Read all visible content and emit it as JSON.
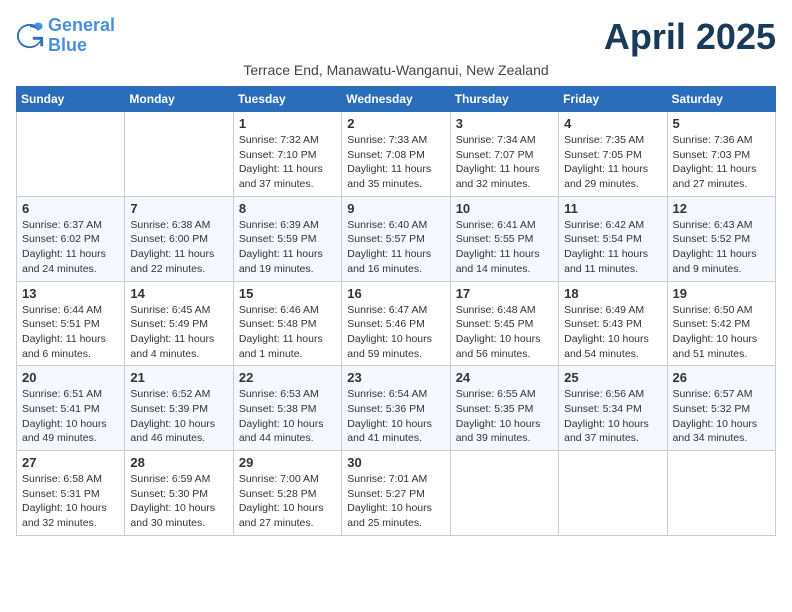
{
  "header": {
    "logo_line1": "General",
    "logo_line2": "Blue",
    "month": "April 2025",
    "subtitle": "Terrace End, Manawatu-Wanganui, New Zealand"
  },
  "days_of_week": [
    "Sunday",
    "Monday",
    "Tuesday",
    "Wednesday",
    "Thursday",
    "Friday",
    "Saturday"
  ],
  "weeks": [
    [
      {
        "day": "",
        "info": ""
      },
      {
        "day": "",
        "info": ""
      },
      {
        "day": "1",
        "info": "Sunrise: 7:32 AM\nSunset: 7:10 PM\nDaylight: 11 hours and 37 minutes."
      },
      {
        "day": "2",
        "info": "Sunrise: 7:33 AM\nSunset: 7:08 PM\nDaylight: 11 hours and 35 minutes."
      },
      {
        "day": "3",
        "info": "Sunrise: 7:34 AM\nSunset: 7:07 PM\nDaylight: 11 hours and 32 minutes."
      },
      {
        "day": "4",
        "info": "Sunrise: 7:35 AM\nSunset: 7:05 PM\nDaylight: 11 hours and 29 minutes."
      },
      {
        "day": "5",
        "info": "Sunrise: 7:36 AM\nSunset: 7:03 PM\nDaylight: 11 hours and 27 minutes."
      }
    ],
    [
      {
        "day": "6",
        "info": "Sunrise: 6:37 AM\nSunset: 6:02 PM\nDaylight: 11 hours and 24 minutes."
      },
      {
        "day": "7",
        "info": "Sunrise: 6:38 AM\nSunset: 6:00 PM\nDaylight: 11 hours and 22 minutes."
      },
      {
        "day": "8",
        "info": "Sunrise: 6:39 AM\nSunset: 5:59 PM\nDaylight: 11 hours and 19 minutes."
      },
      {
        "day": "9",
        "info": "Sunrise: 6:40 AM\nSunset: 5:57 PM\nDaylight: 11 hours and 16 minutes."
      },
      {
        "day": "10",
        "info": "Sunrise: 6:41 AM\nSunset: 5:55 PM\nDaylight: 11 hours and 14 minutes."
      },
      {
        "day": "11",
        "info": "Sunrise: 6:42 AM\nSunset: 5:54 PM\nDaylight: 11 hours and 11 minutes."
      },
      {
        "day": "12",
        "info": "Sunrise: 6:43 AM\nSunset: 5:52 PM\nDaylight: 11 hours and 9 minutes."
      }
    ],
    [
      {
        "day": "13",
        "info": "Sunrise: 6:44 AM\nSunset: 5:51 PM\nDaylight: 11 hours and 6 minutes."
      },
      {
        "day": "14",
        "info": "Sunrise: 6:45 AM\nSunset: 5:49 PM\nDaylight: 11 hours and 4 minutes."
      },
      {
        "day": "15",
        "info": "Sunrise: 6:46 AM\nSunset: 5:48 PM\nDaylight: 11 hours and 1 minute."
      },
      {
        "day": "16",
        "info": "Sunrise: 6:47 AM\nSunset: 5:46 PM\nDaylight: 10 hours and 59 minutes."
      },
      {
        "day": "17",
        "info": "Sunrise: 6:48 AM\nSunset: 5:45 PM\nDaylight: 10 hours and 56 minutes."
      },
      {
        "day": "18",
        "info": "Sunrise: 6:49 AM\nSunset: 5:43 PM\nDaylight: 10 hours and 54 minutes."
      },
      {
        "day": "19",
        "info": "Sunrise: 6:50 AM\nSunset: 5:42 PM\nDaylight: 10 hours and 51 minutes."
      }
    ],
    [
      {
        "day": "20",
        "info": "Sunrise: 6:51 AM\nSunset: 5:41 PM\nDaylight: 10 hours and 49 minutes."
      },
      {
        "day": "21",
        "info": "Sunrise: 6:52 AM\nSunset: 5:39 PM\nDaylight: 10 hours and 46 minutes."
      },
      {
        "day": "22",
        "info": "Sunrise: 6:53 AM\nSunset: 5:38 PM\nDaylight: 10 hours and 44 minutes."
      },
      {
        "day": "23",
        "info": "Sunrise: 6:54 AM\nSunset: 5:36 PM\nDaylight: 10 hours and 41 minutes."
      },
      {
        "day": "24",
        "info": "Sunrise: 6:55 AM\nSunset: 5:35 PM\nDaylight: 10 hours and 39 minutes."
      },
      {
        "day": "25",
        "info": "Sunrise: 6:56 AM\nSunset: 5:34 PM\nDaylight: 10 hours and 37 minutes."
      },
      {
        "day": "26",
        "info": "Sunrise: 6:57 AM\nSunset: 5:32 PM\nDaylight: 10 hours and 34 minutes."
      }
    ],
    [
      {
        "day": "27",
        "info": "Sunrise: 6:58 AM\nSunset: 5:31 PM\nDaylight: 10 hours and 32 minutes."
      },
      {
        "day": "28",
        "info": "Sunrise: 6:59 AM\nSunset: 5:30 PM\nDaylight: 10 hours and 30 minutes."
      },
      {
        "day": "29",
        "info": "Sunrise: 7:00 AM\nSunset: 5:28 PM\nDaylight: 10 hours and 27 minutes."
      },
      {
        "day": "30",
        "info": "Sunrise: 7:01 AM\nSunset: 5:27 PM\nDaylight: 10 hours and 25 minutes."
      },
      {
        "day": "",
        "info": ""
      },
      {
        "day": "",
        "info": ""
      },
      {
        "day": "",
        "info": ""
      }
    ]
  ]
}
